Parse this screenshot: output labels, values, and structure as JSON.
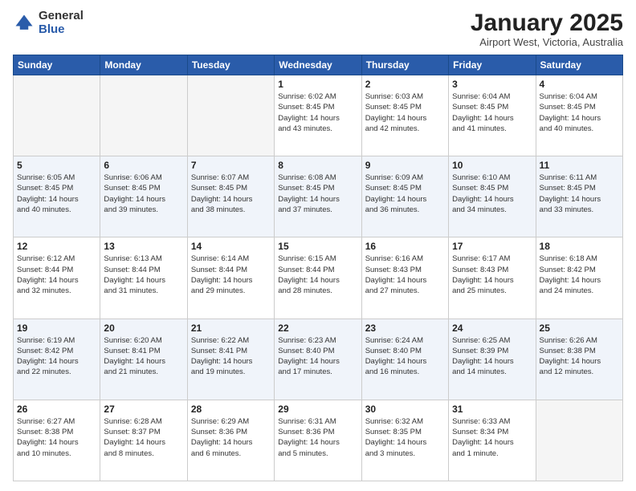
{
  "logo": {
    "general": "General",
    "blue": "Blue"
  },
  "header": {
    "title": "January 2025",
    "subtitle": "Airport West, Victoria, Australia"
  },
  "weekdays": [
    "Sunday",
    "Monday",
    "Tuesday",
    "Wednesday",
    "Thursday",
    "Friday",
    "Saturday"
  ],
  "weeks": [
    [
      {
        "day": "",
        "info": ""
      },
      {
        "day": "",
        "info": ""
      },
      {
        "day": "",
        "info": ""
      },
      {
        "day": "1",
        "info": "Sunrise: 6:02 AM\nSunset: 8:45 PM\nDaylight: 14 hours\nand 43 minutes."
      },
      {
        "day": "2",
        "info": "Sunrise: 6:03 AM\nSunset: 8:45 PM\nDaylight: 14 hours\nand 42 minutes."
      },
      {
        "day": "3",
        "info": "Sunrise: 6:04 AM\nSunset: 8:45 PM\nDaylight: 14 hours\nand 41 minutes."
      },
      {
        "day": "4",
        "info": "Sunrise: 6:04 AM\nSunset: 8:45 PM\nDaylight: 14 hours\nand 40 minutes."
      }
    ],
    [
      {
        "day": "5",
        "info": "Sunrise: 6:05 AM\nSunset: 8:45 PM\nDaylight: 14 hours\nand 40 minutes."
      },
      {
        "day": "6",
        "info": "Sunrise: 6:06 AM\nSunset: 8:45 PM\nDaylight: 14 hours\nand 39 minutes."
      },
      {
        "day": "7",
        "info": "Sunrise: 6:07 AM\nSunset: 8:45 PM\nDaylight: 14 hours\nand 38 minutes."
      },
      {
        "day": "8",
        "info": "Sunrise: 6:08 AM\nSunset: 8:45 PM\nDaylight: 14 hours\nand 37 minutes."
      },
      {
        "day": "9",
        "info": "Sunrise: 6:09 AM\nSunset: 8:45 PM\nDaylight: 14 hours\nand 36 minutes."
      },
      {
        "day": "10",
        "info": "Sunrise: 6:10 AM\nSunset: 8:45 PM\nDaylight: 14 hours\nand 34 minutes."
      },
      {
        "day": "11",
        "info": "Sunrise: 6:11 AM\nSunset: 8:45 PM\nDaylight: 14 hours\nand 33 minutes."
      }
    ],
    [
      {
        "day": "12",
        "info": "Sunrise: 6:12 AM\nSunset: 8:44 PM\nDaylight: 14 hours\nand 32 minutes."
      },
      {
        "day": "13",
        "info": "Sunrise: 6:13 AM\nSunset: 8:44 PM\nDaylight: 14 hours\nand 31 minutes."
      },
      {
        "day": "14",
        "info": "Sunrise: 6:14 AM\nSunset: 8:44 PM\nDaylight: 14 hours\nand 29 minutes."
      },
      {
        "day": "15",
        "info": "Sunrise: 6:15 AM\nSunset: 8:44 PM\nDaylight: 14 hours\nand 28 minutes."
      },
      {
        "day": "16",
        "info": "Sunrise: 6:16 AM\nSunset: 8:43 PM\nDaylight: 14 hours\nand 27 minutes."
      },
      {
        "day": "17",
        "info": "Sunrise: 6:17 AM\nSunset: 8:43 PM\nDaylight: 14 hours\nand 25 minutes."
      },
      {
        "day": "18",
        "info": "Sunrise: 6:18 AM\nSunset: 8:42 PM\nDaylight: 14 hours\nand 24 minutes."
      }
    ],
    [
      {
        "day": "19",
        "info": "Sunrise: 6:19 AM\nSunset: 8:42 PM\nDaylight: 14 hours\nand 22 minutes."
      },
      {
        "day": "20",
        "info": "Sunrise: 6:20 AM\nSunset: 8:41 PM\nDaylight: 14 hours\nand 21 minutes."
      },
      {
        "day": "21",
        "info": "Sunrise: 6:22 AM\nSunset: 8:41 PM\nDaylight: 14 hours\nand 19 minutes."
      },
      {
        "day": "22",
        "info": "Sunrise: 6:23 AM\nSunset: 8:40 PM\nDaylight: 14 hours\nand 17 minutes."
      },
      {
        "day": "23",
        "info": "Sunrise: 6:24 AM\nSunset: 8:40 PM\nDaylight: 14 hours\nand 16 minutes."
      },
      {
        "day": "24",
        "info": "Sunrise: 6:25 AM\nSunset: 8:39 PM\nDaylight: 14 hours\nand 14 minutes."
      },
      {
        "day": "25",
        "info": "Sunrise: 6:26 AM\nSunset: 8:38 PM\nDaylight: 14 hours\nand 12 minutes."
      }
    ],
    [
      {
        "day": "26",
        "info": "Sunrise: 6:27 AM\nSunset: 8:38 PM\nDaylight: 14 hours\nand 10 minutes."
      },
      {
        "day": "27",
        "info": "Sunrise: 6:28 AM\nSunset: 8:37 PM\nDaylight: 14 hours\nand 8 minutes."
      },
      {
        "day": "28",
        "info": "Sunrise: 6:29 AM\nSunset: 8:36 PM\nDaylight: 14 hours\nand 6 minutes."
      },
      {
        "day": "29",
        "info": "Sunrise: 6:31 AM\nSunset: 8:36 PM\nDaylight: 14 hours\nand 5 minutes."
      },
      {
        "day": "30",
        "info": "Sunrise: 6:32 AM\nSunset: 8:35 PM\nDaylight: 14 hours\nand 3 minutes."
      },
      {
        "day": "31",
        "info": "Sunrise: 6:33 AM\nSunset: 8:34 PM\nDaylight: 14 hours\nand 1 minute."
      },
      {
        "day": "",
        "info": ""
      }
    ]
  ]
}
